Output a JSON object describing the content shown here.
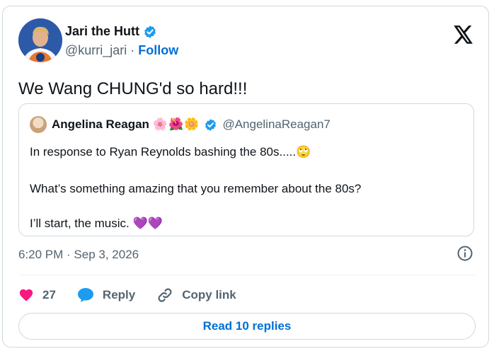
{
  "tweet": {
    "author_name": "Jari the Hutt",
    "handle": "@kurri_jari",
    "separator": " · ",
    "follow_label": "Follow",
    "text": "We Wang CHUNG'd so hard!!!",
    "timestamp": "6:20 PM · Sep 3, 2026",
    "likes": "27",
    "reply_label": "Reply",
    "copy_link_label": "Copy link",
    "read_replies_label": "Read 10 replies"
  },
  "quoted_tweet": {
    "author_name": "Angelina Reagan",
    "name_emojis": "🌸🌺🌼",
    "handle": "@AngelinaReagan7",
    "line1": "In response to Ryan Reynolds bashing the 80s.....🙄",
    "line2": "What’s something amazing that you remember about the 80s?",
    "line3": "I’ll start, the music. 💜💜"
  },
  "colors": {
    "accent": "#1d9bf0",
    "link": "#006fd6",
    "like": "#f91880",
    "secondary_text": "#536471",
    "border": "#cfd9de"
  },
  "icons": [
    "verified-badge-icon",
    "x-logo-icon",
    "info-icon",
    "heart-icon",
    "reply-bubble-icon",
    "link-icon"
  ]
}
